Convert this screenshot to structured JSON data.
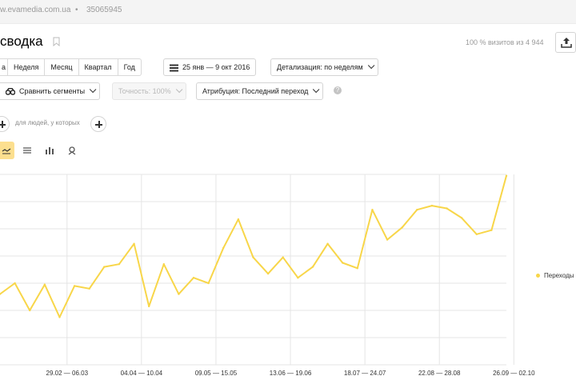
{
  "topbar": {
    "site": "w.evamedia.com.ua",
    "separator": "•",
    "counter_id": "35065945"
  },
  "header": {
    "title": "сводка",
    "visits_info": "100 % визитов из 4 944"
  },
  "periods": [
    "а",
    "Неделя",
    "Месяц",
    "Квартал",
    "Год"
  ],
  "date_range": "25 янв — 9 окт 2016",
  "detail": "Детализация: по неделям",
  "compare": "Сравнить сегменты",
  "accuracy": "Точность: 100%",
  "attribution": "Атрибуция: Последний переход",
  "help": "?",
  "segment_hint": "для людей, у которых",
  "chart_tabs": [
    "line-chart-icon",
    "stacked-chart-icon",
    "bar-chart-icon",
    "map-pin-icon"
  ],
  "colors": {
    "series": "#f8d649",
    "grid": "#e5e5e5",
    "active_tab": "#fcdf8f"
  },
  "chart_data": {
    "type": "line",
    "title": "",
    "xlabel": "",
    "ylabel": "",
    "y_axis_labels_visible": false,
    "ylim": [
      0,
      7
    ],
    "grid": true,
    "legend": "right",
    "x_tick_labels": [
      "29.02 — 06.03",
      "04.04 — 10.04",
      "09.05 — 15.05",
      "13.06 — 19.06",
      "18.07 — 24.07",
      "22.08 — 28.08",
      "26.09 — 02.10"
    ],
    "x_tick_index": [
      5,
      10,
      15,
      20,
      25,
      30,
      35
    ],
    "series": [
      {
        "name": "Переходы",
        "values": [
          2.6,
          3.0,
          2.0,
          2.95,
          1.75,
          2.9,
          2.8,
          3.6,
          3.7,
          4.45,
          2.15,
          3.7,
          2.6,
          3.2,
          3.0,
          4.3,
          5.35,
          3.95,
          3.35,
          3.95,
          3.2,
          3.6,
          4.45,
          3.75,
          3.55,
          5.7,
          4.6,
          5.05,
          5.7,
          5.85,
          5.75,
          5.4,
          4.8,
          4.95,
          6.95
        ]
      }
    ]
  }
}
